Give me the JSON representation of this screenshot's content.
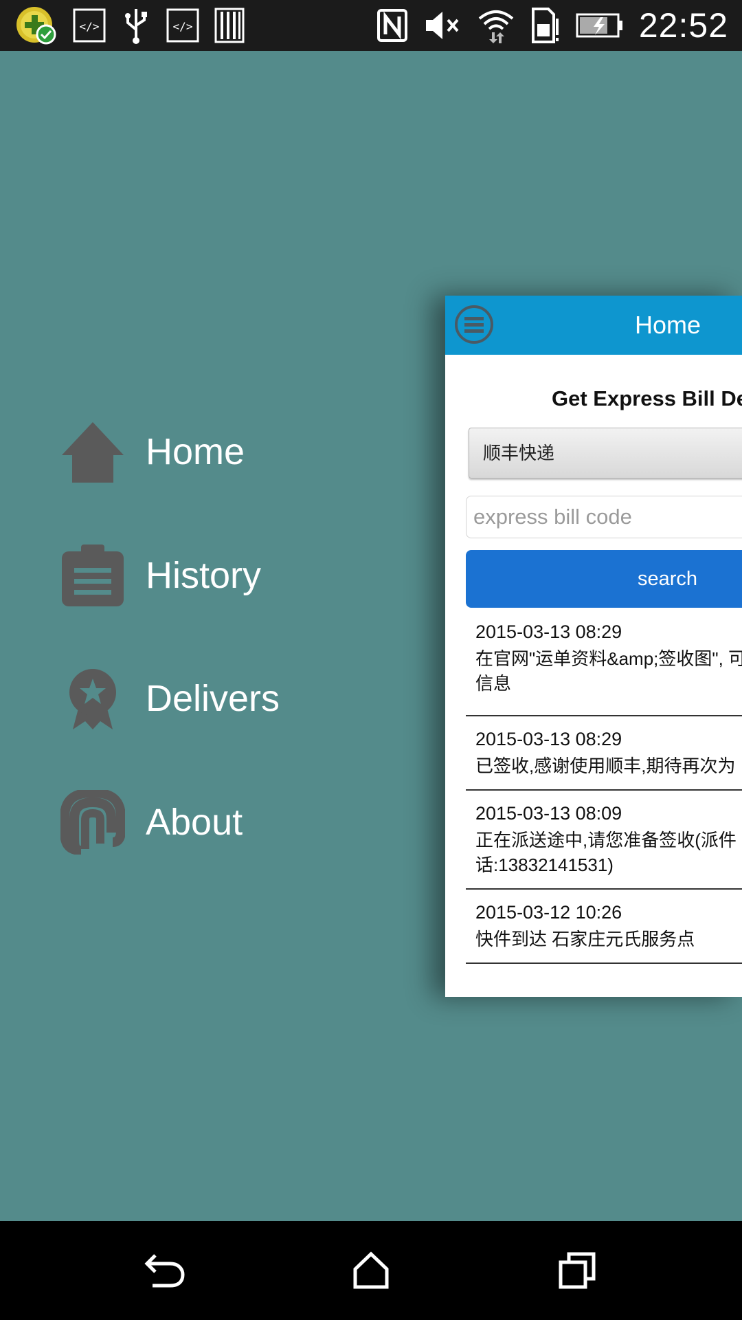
{
  "status_bar": {
    "left_icons": [
      "app-badge-icon",
      "code-icon",
      "usb-icon",
      "code-icon",
      "barcode-icon"
    ],
    "right_icons": [
      "nfc-icon",
      "mute-icon",
      "wifi-icon",
      "sim-alert-icon",
      "battery-charging-icon"
    ],
    "time": "22:52"
  },
  "side_menu": {
    "items": [
      {
        "label": "Home",
        "icon": "home-icon"
      },
      {
        "label": "History",
        "icon": "clipboard-icon"
      },
      {
        "label": "Delivers",
        "icon": "award-icon"
      },
      {
        "label": "About",
        "icon": "paperclip-icon"
      }
    ]
  },
  "card": {
    "header_title": "Home",
    "form_title": "Get Express Bill Det",
    "carrier_selected": "顺丰快递",
    "bill_code_placeholder": "express bill code",
    "bill_code_value": "",
    "search_label": "search",
    "results": [
      {
        "date": "2015-03-13 08:29",
        "text": "在官网\"运单资料&amp;签收图\", 可\n信息"
      },
      {
        "date": "2015-03-13 08:29",
        "text": "已签收,感谢使用顺丰,期待再次为"
      },
      {
        "date": "2015-03-13 08:09",
        "text": "正在派送途中,请您准备签收(派件\n话:13832141531)"
      },
      {
        "date": "2015-03-12 10:26",
        "text": "快件到达 石家庄元氏服务点"
      }
    ]
  },
  "colors": {
    "background": "#548b8b",
    "header": "#0e96cf",
    "button": "#1b72d2",
    "menu_icon": "#5a5a5a"
  }
}
